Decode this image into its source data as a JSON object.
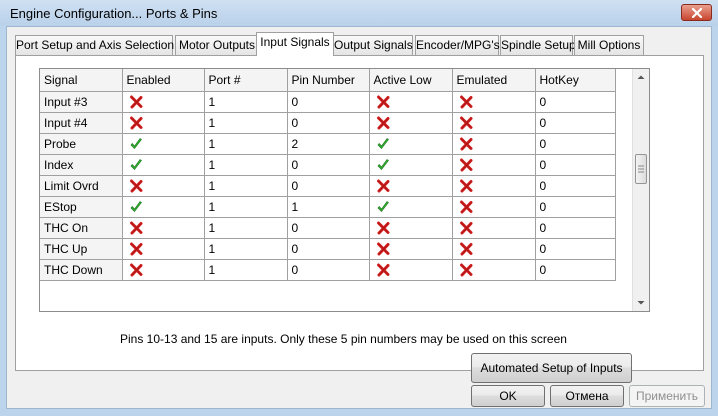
{
  "window": {
    "title": "Engine Configuration... Ports & Pins"
  },
  "tabs": [
    {
      "label": "Port Setup and Axis Selection",
      "active": false
    },
    {
      "label": "Motor Outputs",
      "active": false
    },
    {
      "label": "Input Signals",
      "active": true
    },
    {
      "label": "Output Signals",
      "active": false
    },
    {
      "label": "Encoder/MPG's",
      "active": false
    },
    {
      "label": "Spindle Setup",
      "active": false
    },
    {
      "label": "Mill Options",
      "active": false
    }
  ],
  "table": {
    "headers": [
      "Signal",
      "Enabled",
      "Port #",
      "Pin Number",
      "Active Low",
      "Emulated",
      "HotKey"
    ],
    "rows": [
      {
        "signal": "Input #3",
        "enabled": false,
        "port": "1",
        "pin": "0",
        "active_low": false,
        "emulated": false,
        "hotkey": "0"
      },
      {
        "signal": "Input #4",
        "enabled": false,
        "port": "1",
        "pin": "0",
        "active_low": false,
        "emulated": false,
        "hotkey": "0"
      },
      {
        "signal": "Probe",
        "enabled": true,
        "port": "1",
        "pin": "2",
        "active_low": true,
        "emulated": false,
        "hotkey": "0"
      },
      {
        "signal": "Index",
        "enabled": true,
        "port": "1",
        "pin": "0",
        "active_low": true,
        "emulated": false,
        "hotkey": "0"
      },
      {
        "signal": "Limit Ovrd",
        "enabled": false,
        "port": "1",
        "pin": "0",
        "active_low": false,
        "emulated": false,
        "hotkey": "0"
      },
      {
        "signal": "EStop",
        "enabled": true,
        "port": "1",
        "pin": "1",
        "active_low": true,
        "emulated": false,
        "hotkey": "0"
      },
      {
        "signal": "THC On",
        "enabled": false,
        "port": "1",
        "pin": "0",
        "active_low": false,
        "emulated": false,
        "hotkey": "0"
      },
      {
        "signal": "THC Up",
        "enabled": false,
        "port": "1",
        "pin": "0",
        "active_low": false,
        "emulated": false,
        "hotkey": "0"
      },
      {
        "signal": "THC Down",
        "enabled": false,
        "port": "1",
        "pin": "0",
        "active_low": false,
        "emulated": false,
        "hotkey": "0"
      }
    ]
  },
  "info_text": "Pins 10-13 and 15 are inputs. Only these 5 pin numbers may be used on this screen",
  "buttons": {
    "automated_setup": "Automated Setup of Inputs",
    "ok": "OK",
    "cancel": "Отмена",
    "apply": "Применить"
  },
  "icons": {
    "check": "green-check-icon",
    "cross": "red-cross-icon"
  },
  "colors": {
    "check": "#2fb52f",
    "cross": "#d21f1f"
  }
}
